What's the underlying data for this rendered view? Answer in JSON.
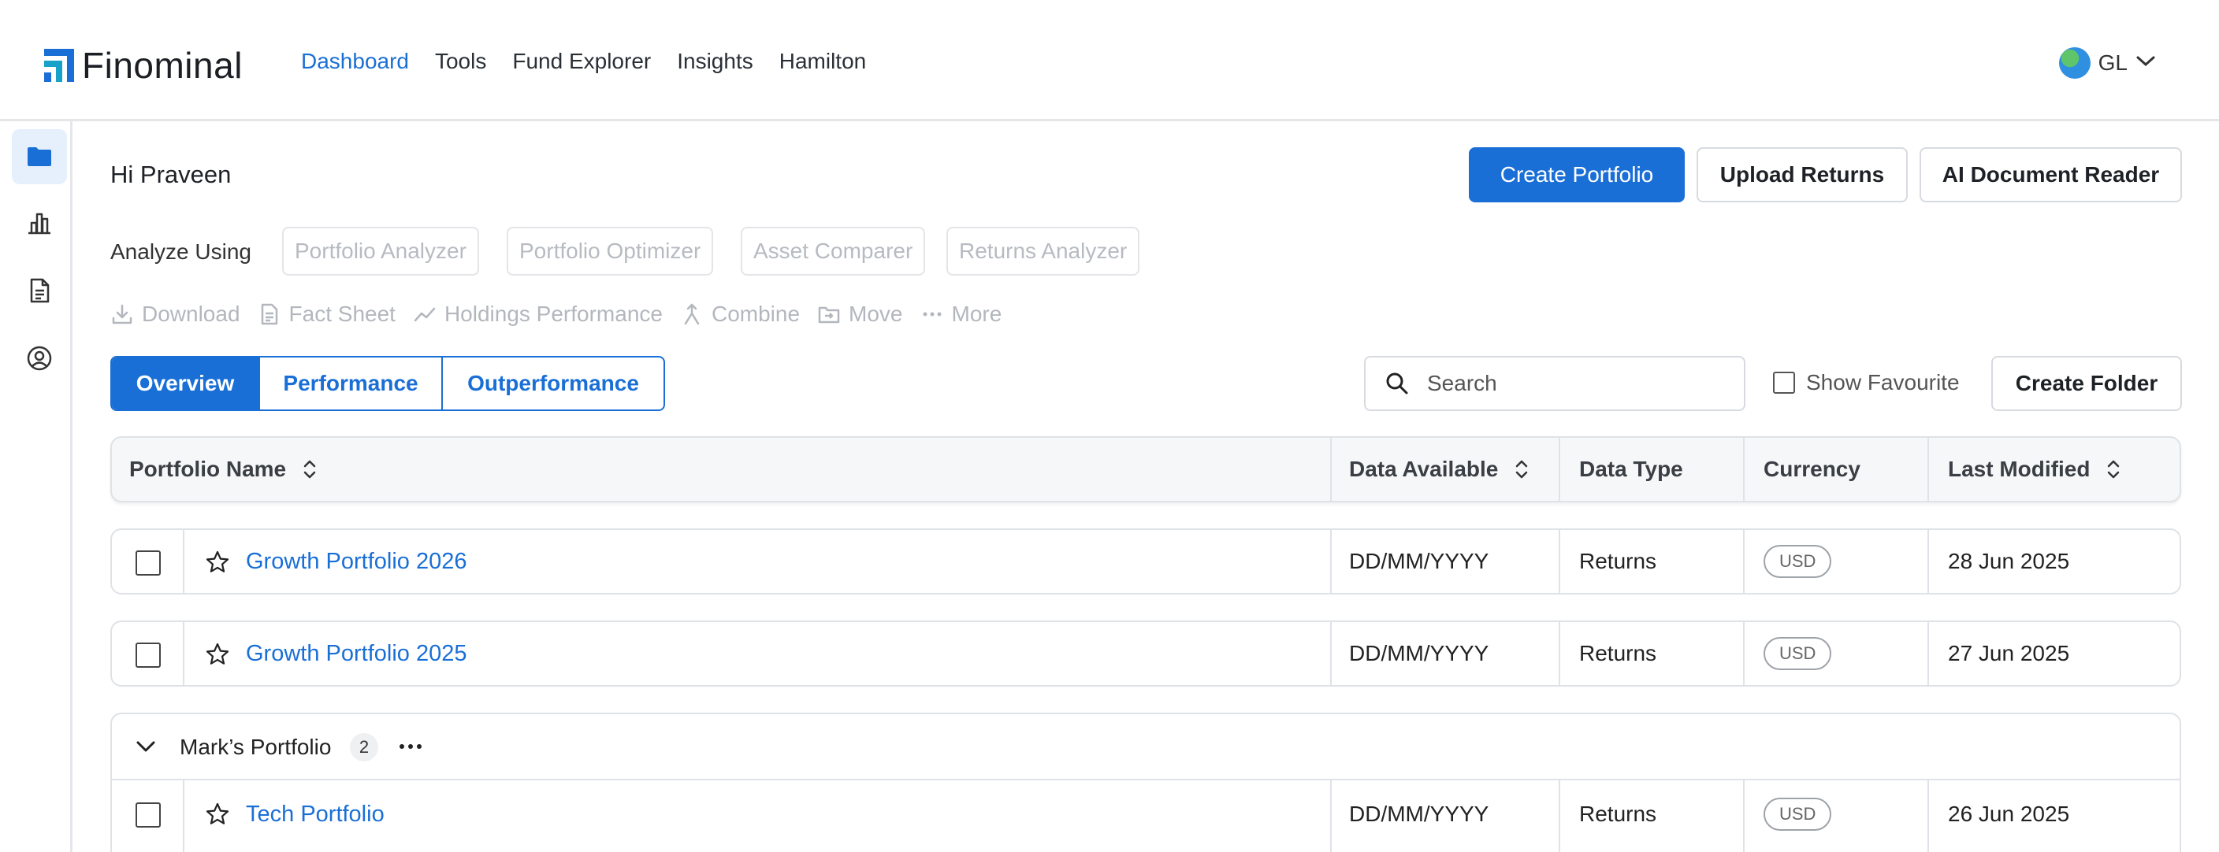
{
  "brand": {
    "name": "Finominal",
    "accent": "#1a6fd6"
  },
  "nav": {
    "items": [
      "Dashboard",
      "Tools",
      "Fund Explorer",
      "Insights",
      "Hamilton"
    ],
    "active": "Dashboard"
  },
  "language": {
    "code": "GL",
    "icon": "globe-icon"
  },
  "sidebar": {
    "items": [
      {
        "name": "folder-icon",
        "active": true
      },
      {
        "name": "bar-chart-icon",
        "active": false
      },
      {
        "name": "document-icon",
        "active": false
      },
      {
        "name": "user-circle-icon",
        "active": false
      }
    ]
  },
  "greeting": "Hi Praveen",
  "header_buttons": {
    "create_portfolio": "Create Portfolio",
    "upload_returns": "Upload Returns",
    "ai_reader": "AI Document Reader"
  },
  "analyze": {
    "label": "Analyze Using",
    "tools": [
      "Portfolio Analyzer",
      "Portfolio Optimizer",
      "Asset Comparer",
      "Returns Analyzer"
    ]
  },
  "actions": {
    "download": "Download",
    "fact_sheet": "Fact Sheet",
    "holdings_performance": "Holdings Performance",
    "combine": "Combine",
    "move": "Move",
    "more": "More"
  },
  "tabs": {
    "overview": "Overview",
    "performance": "Performance",
    "outperformance": "Outperformance",
    "active": "Overview"
  },
  "search": {
    "placeholder": "Search",
    "value": ""
  },
  "favourite": {
    "label": "Show Favourite",
    "checked": false
  },
  "create_folder": "Create Folder",
  "table": {
    "columns": {
      "name": "Portfolio Name",
      "data_available": "Data Available",
      "data_type": "Data Type",
      "currency": "Currency",
      "last_modified": "Last Modified"
    },
    "rows": [
      {
        "name": "Growth Portfolio 2026",
        "data_available": "DD/MM/YYYY",
        "data_type": "Returns",
        "currency": "USD",
        "last_modified": "28 Jun 2025"
      },
      {
        "name": "Growth Portfolio 2025",
        "data_available": "DD/MM/YYYY",
        "data_type": "Returns",
        "currency": "USD",
        "last_modified": "27 Jun 2025"
      }
    ],
    "group": {
      "name": "Mark’s Portfolio",
      "count": "2",
      "rows": [
        {
          "name": "Tech Portfolio",
          "data_available": "DD/MM/YYYY",
          "data_type": "Returns",
          "currency": "USD",
          "last_modified": "26 Jun 2025"
        }
      ]
    }
  }
}
